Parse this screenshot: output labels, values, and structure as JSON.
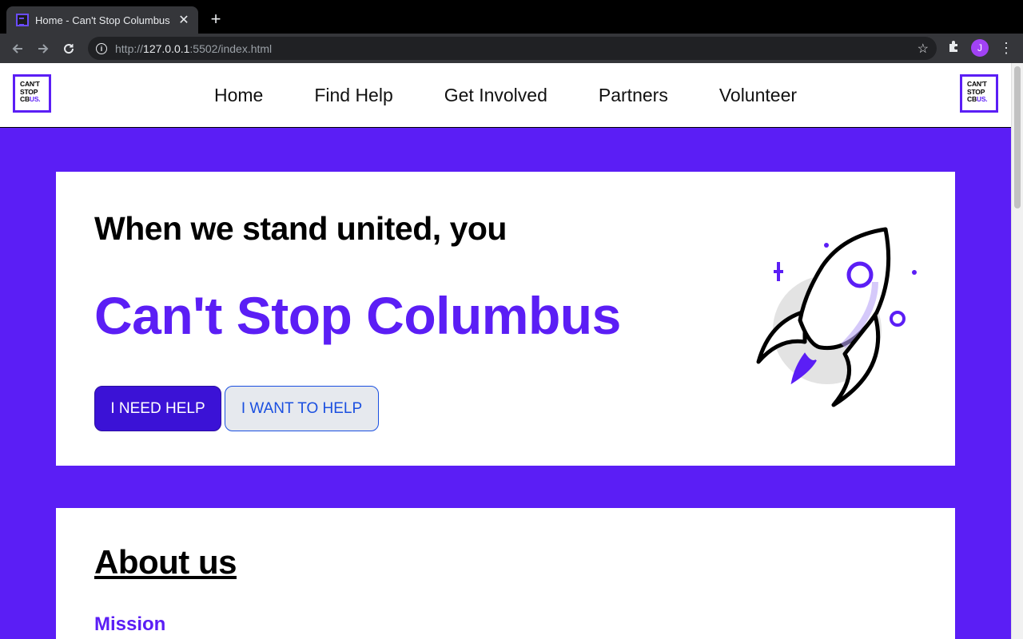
{
  "browser": {
    "tab_title": "Home - Can't Stop Columbus",
    "tab_close": "✕",
    "new_tab": "+",
    "url_scheme": "http://",
    "url_host": "127.0.0.1",
    "url_rest": ":5502/index.html",
    "profile_initial": "J"
  },
  "logo": {
    "line1": "CAN'T",
    "line2": "STOP",
    "line3_a": "CB",
    "line3_b": "US."
  },
  "nav": {
    "items": [
      "Home",
      "Find Help",
      "Get Involved",
      "Partners",
      "Volunteer"
    ]
  },
  "hero": {
    "tagline": "When we stand united, you",
    "brand": "Can't Stop Columbus",
    "primary_button": "I NEED HELP",
    "secondary_button": "I WANT TO HELP"
  },
  "about": {
    "heading": "About us",
    "subheading": "Mission"
  },
  "colors": {
    "brand_purple": "#5b1ef5",
    "button_purple": "#3b12d6",
    "link_blue": "#1a4fe0"
  }
}
